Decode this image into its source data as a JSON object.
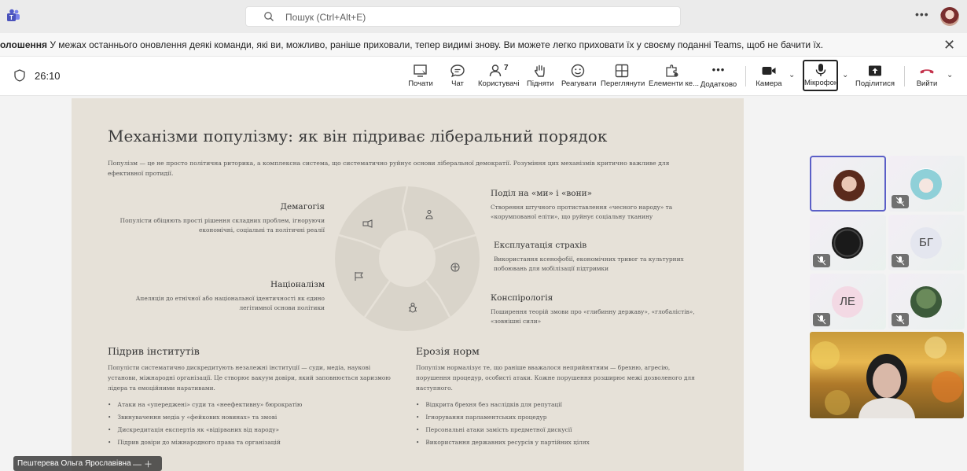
{
  "search": {
    "placeholder": "Пошук (Ctrl+Alt+E)"
  },
  "notification": {
    "bold": "олошення",
    "text": " У межах останнього оновлення деякі команди, які ви, можливо, раніше приховали, тепер видимі знову. Ви можете легко приховати їх у своєму поданні Teams, щоб не бачити їх."
  },
  "meeting": {
    "timer": "26:10",
    "tools": {
      "start": "Почати",
      "chat": "Чат",
      "people": "Користувачі",
      "people_count": "7",
      "raise": "Підняти",
      "react": "Реагувати",
      "view": "Переглянути",
      "apps": "Елементи ке...",
      "more": "Додатково",
      "camera": "Камера",
      "mic": "Мікрофон",
      "share": "Поділитися",
      "leave": "Вийти"
    }
  },
  "slide": {
    "title": "Механізми популізму: як він підриває ліберальний порядок",
    "intro": "Популізм — це не просто політична риторика, а комплексна система, що систематично руйнує основи ліберальної демократії. Розуміння цих механізмів критично важливе для ефективної протидії.",
    "left_blocks": [
      {
        "h": "Демагогія",
        "t": "Популісти обіцяють прості рішення складних проблем, ігноруючи економічні, соціальні та політичні реалії"
      },
      {
        "h": "Націоналізм",
        "t": "Апеляція до етнічної або національної ідентичності як єдино легітимної основи політики"
      }
    ],
    "right_blocks": [
      {
        "h": "Поділ на «ми» і «вони»",
        "t": "Створення штучного протиставлення «чесного народу» та «корумпованої еліти», що руйнує соціальну тканину"
      },
      {
        "h": "Експлуатація страхів",
        "t": "Використання ксенофобії, економічних тривог та культурних побоювань для мобілізації підтримки"
      },
      {
        "h": "Конспірологія",
        "t": "Поширення теорій змови про «глибинну державу», «глобалістів», «зовнішні сили»"
      }
    ],
    "institutions": {
      "h": "Підрив інститутів",
      "t": "Популісти систематично дискредитують незалежні інституції — суди, медіа, наукові установи, міжнародні організації. Це створює вакуум довіри, який заповнюється харизмою лідера та емоційними наративами.",
      "bullets": [
        "Атаки на «упереджені» суди та «неефективну» бюрократію",
        "Звинувачення медіа у «фейкових новинах» та змові",
        "Дискредитація експертів як «відірваних від народу»",
        "Підрив довіри до міжнародного права та організацій"
      ]
    },
    "norms": {
      "h": "Ерозія норм",
      "t": "Популізм нормалізує те, що раніше вважалося неприйнятним — брехню, агресію, порушення процедур, особисті атаки. Кожне порушення розширює межі дозволеного для наступного.",
      "bullets": [
        "Відкрита брехня без наслідків для репутації",
        "Ігнорування парламентських процедур",
        "Персональні атаки замість предметної дискусії",
        "Використання державних ресурсів у партійних цілях"
      ]
    }
  },
  "participants": {
    "initials": [
      "БГ",
      "ЛЕ"
    ],
    "presenter_name": "Пештерева Ольга Ярославівна"
  },
  "colors": {
    "accent": "#5b5fc7",
    "leave": "#c4314b",
    "slide_bg": "#e6e1d8"
  }
}
